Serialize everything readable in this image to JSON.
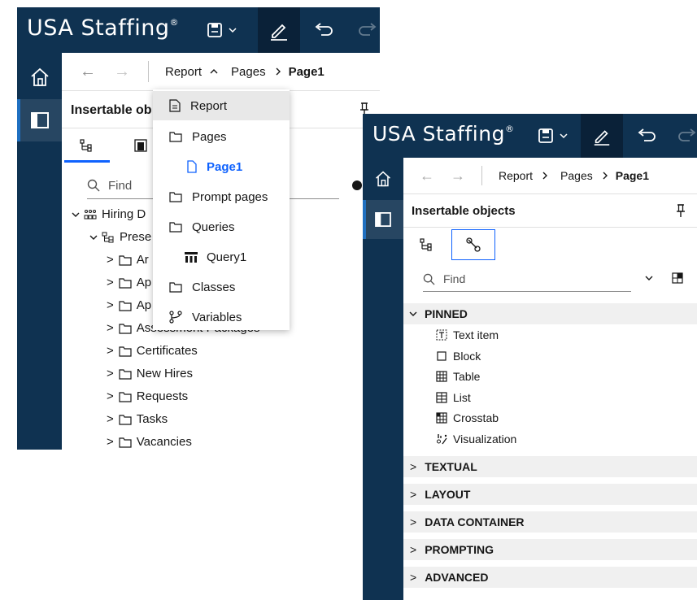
{
  "brand": {
    "name": "USA Staffing",
    "reg": "®"
  },
  "left": {
    "breadcrumb": {
      "report": "Report",
      "pages": "Pages",
      "page": "Page1"
    },
    "panel_title": "Insertable ob",
    "find_placeholder": "Find",
    "tree": {
      "root": "Hiring D",
      "child": "Prese",
      "folders_partial": [
        "Ar",
        "Ap",
        "Ap"
      ],
      "partial_folder": "Assessment Packages",
      "folders": [
        "Certificates",
        "New Hires",
        "Requests",
        "Tasks",
        "Vacancies"
      ]
    },
    "menu": {
      "items": [
        "Report",
        "Pages",
        "Page1",
        "Prompt pages",
        "Queries",
        "Query1",
        "Classes",
        "Variables"
      ]
    }
  },
  "right": {
    "breadcrumb": {
      "report": "Report",
      "pages": "Pages",
      "page": "Page1"
    },
    "panel_title": "Insertable objects",
    "find_placeholder": "Find",
    "pinned_label": "PINNED",
    "pinned_items": [
      "Text item",
      "Block",
      "Table",
      "List",
      "Crosstab",
      "Visualization"
    ],
    "sections": [
      "TEXTUAL",
      "LAYOUT",
      "DATA CONTAINER",
      "PROMPTING",
      "ADVANCED"
    ]
  }
}
